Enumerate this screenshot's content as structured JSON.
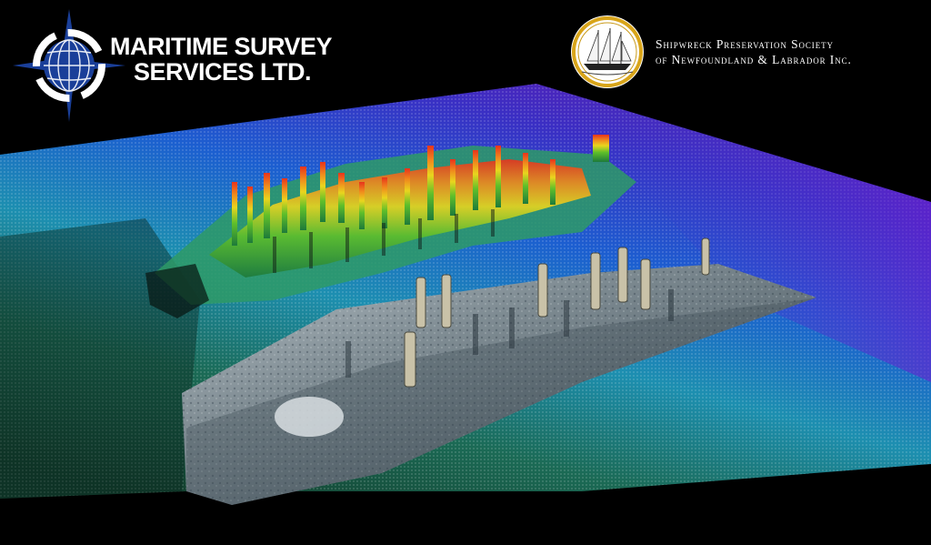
{
  "left_logo": {
    "line1": "MARITIME SURVEY",
    "line2": "SERVICES LTD.",
    "colors": {
      "navy": "#0e2a6e",
      "globe": "#1a3f99",
      "text": "#ffffff"
    },
    "icon": "compass-globe-icon"
  },
  "right_logo": {
    "line1": "Shipwreck Preservation Society",
    "line2": "of Newfoundland & Labrador Inc.",
    "colors": {
      "ring": "#d9a51a",
      "text": "#ffffff"
    },
    "icon": "schooner-seal-icon"
  },
  "scene": {
    "colors": {
      "seabed_far": "#3b1fae",
      "seabed_mid": "#1c8fc6",
      "seabed_near": "#1f7f5e",
      "high_relief": "#e8331c"
    }
  }
}
